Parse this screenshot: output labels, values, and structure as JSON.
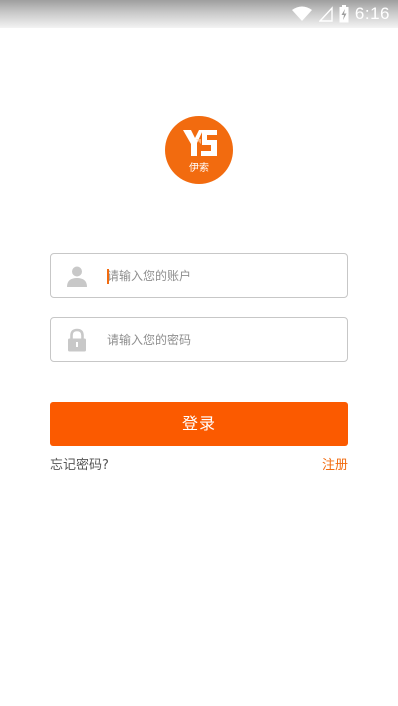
{
  "status_bar": {
    "time": "6:16",
    "icons": [
      "wifi-icon",
      "signal-icon",
      "battery-charging-icon"
    ]
  },
  "logo": {
    "brand_text": "伊索",
    "color": "#f26b0f"
  },
  "form": {
    "account_placeholder": "请输入您的账户",
    "password_placeholder": "请输入您的密码",
    "account_icon": "user-icon",
    "password_icon": "lock-icon"
  },
  "login_button": {
    "label": "登录",
    "color": "#fb5a00"
  },
  "links": {
    "forgot_password": "忘记密码?",
    "register": "注册",
    "register_color": "#f26b0f"
  }
}
